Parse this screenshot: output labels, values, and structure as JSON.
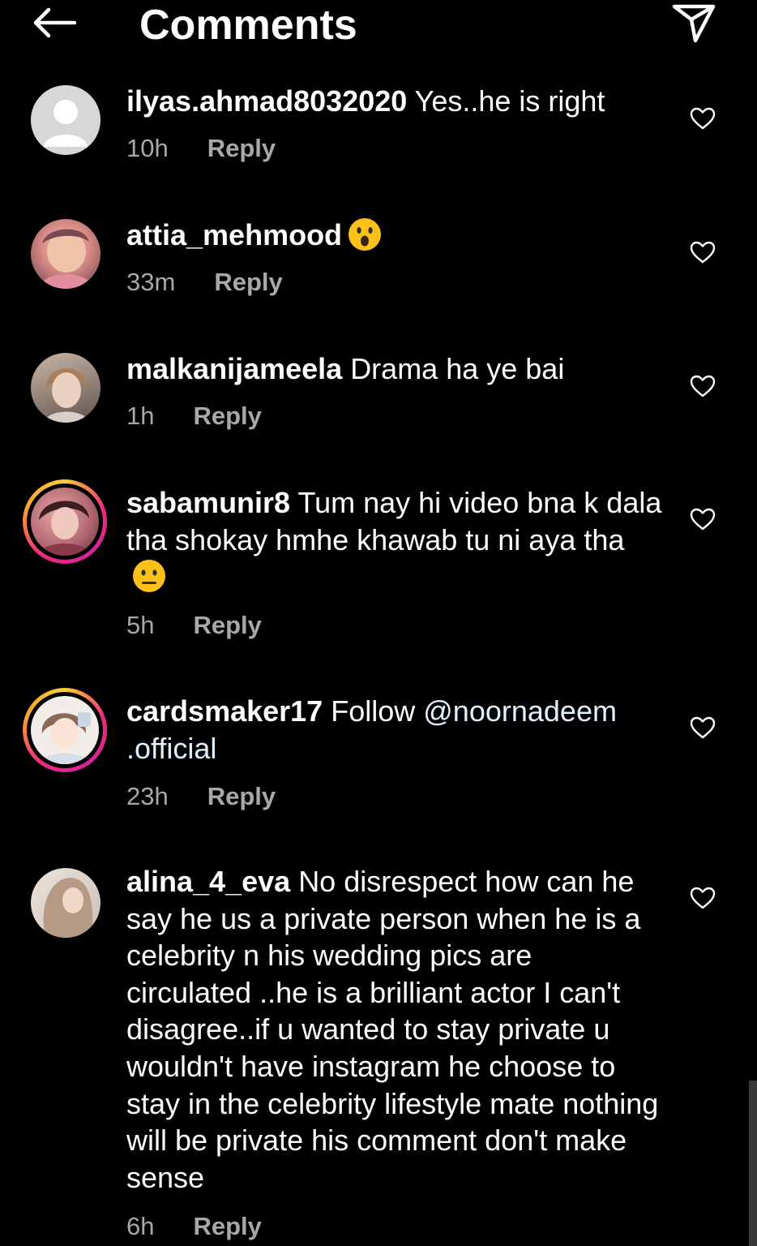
{
  "header": {
    "title": "Comments",
    "back_icon": "arrow-left-icon",
    "share_icon": "send-icon"
  },
  "comments": [
    {
      "username": "ilyas.ahmad8032020",
      "text": "Yes..he is right",
      "time": "10h",
      "reply": "Reply",
      "emoji": null
    },
    {
      "username": "attia_mehmood",
      "text": "",
      "time": "33m",
      "reply": "Reply",
      "emoji": "astonished-face"
    },
    {
      "username": "malkanijameela",
      "text": "Drama ha ye bai",
      "time": "1h",
      "reply": "Reply",
      "emoji": null
    },
    {
      "username": "sabamunir8",
      "text": "Tum nay hi video bna k dala tha shokay hmhe khawab tu ni aya tha",
      "time": "5h",
      "reply": "Reply",
      "emoji": "neutral-face"
    },
    {
      "username": "cardsmaker17",
      "text": "Follow",
      "mention": "@noornadeem .official",
      "time": "23h",
      "reply": "Reply",
      "emoji": null
    },
    {
      "username": "alina_4_eva",
      "text": "No disrespect how can he say he us a private person when he is a celebrity n his wedding pics are circulated ..he is  a brilliant actor I can't disagree..if u wanted to stay private u wouldn't have instagram he choose to stay in the celebrity lifestyle mate nothing will be private his comment don't make sense",
      "time": "6h",
      "reply": "Reply",
      "emoji": null
    }
  ],
  "colors": {
    "background": "#000000",
    "text": "#ffffff",
    "meta": "#a8a8a8"
  }
}
